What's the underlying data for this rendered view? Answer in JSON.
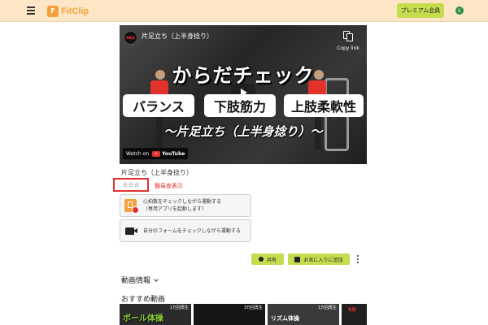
{
  "header": {
    "logo_text": "FitClip",
    "premium_label": "プレミアム会員",
    "avatar_initial": "k"
  },
  "video": {
    "channel_badge": "BBJA",
    "title": "片足立ち（上半身捻り）",
    "copy_link_label": "Copy link",
    "big_title": "からだチェック",
    "pills": [
      "バランス",
      "下肢筋力",
      "上肢柔軟性"
    ],
    "subtitle": "〜片足立ち（上半身捻り）〜",
    "watch_on": "Watch on",
    "youtube": "YouTube"
  },
  "exercise": {
    "title": "片足立ち（上半身捻り）",
    "difficulty_stars": "☆☆☆",
    "difficulty_label": "難易度表示"
  },
  "actions": {
    "heart_rate_line1": "心拍数をチェックしながら運動する",
    "heart_rate_line2": "（専用アプリを起動します）",
    "form_check": "自分のフォームをチェックしながら運動する"
  },
  "buttons": {
    "share": "共有",
    "favorite": "お気に入りに追加"
  },
  "sections": {
    "video_info": "動画情報",
    "recommended": "おすすめ動画"
  },
  "recommended": [
    {
      "views": "1万回再生",
      "text_green": "ボール体操",
      "text_white": "",
      "text_red": ""
    },
    {
      "views": "3万回再生",
      "text_green": "",
      "text_white": "",
      "text_red": ""
    },
    {
      "views": "1万回再生",
      "text_green": "",
      "text_white": "リズム体操",
      "text_red": ""
    },
    {
      "views": "",
      "text_green": "",
      "text_white": "",
      "text_red": "5分"
    }
  ],
  "colors": {
    "header_bg": "#fde6c6",
    "brand_orange": "#f2a13a",
    "accent_green": "#c6dc4f",
    "highlight_red": "#e03030"
  }
}
